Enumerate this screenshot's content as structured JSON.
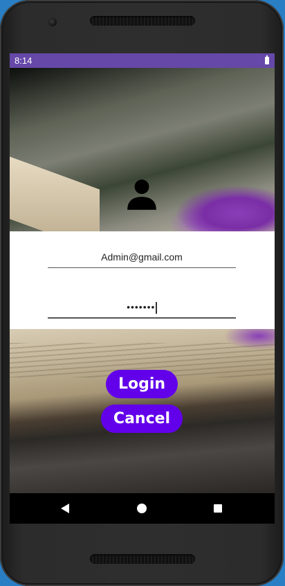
{
  "status_bar": {
    "time": "8:14"
  },
  "login_form": {
    "email_value": "Admin@gmail.com",
    "password_masked": "•••••••"
  },
  "buttons": {
    "login_label": "Login",
    "cancel_label": "Cancel"
  },
  "colors": {
    "status_bar": "#6548a8",
    "button_primary": "#6200ea",
    "form_background": "#ffffff"
  },
  "icons": {
    "avatar": "person-icon",
    "battery": "battery-icon",
    "nav_back": "back-icon",
    "nav_home": "home-icon",
    "nav_recent": "recent-apps-icon"
  }
}
